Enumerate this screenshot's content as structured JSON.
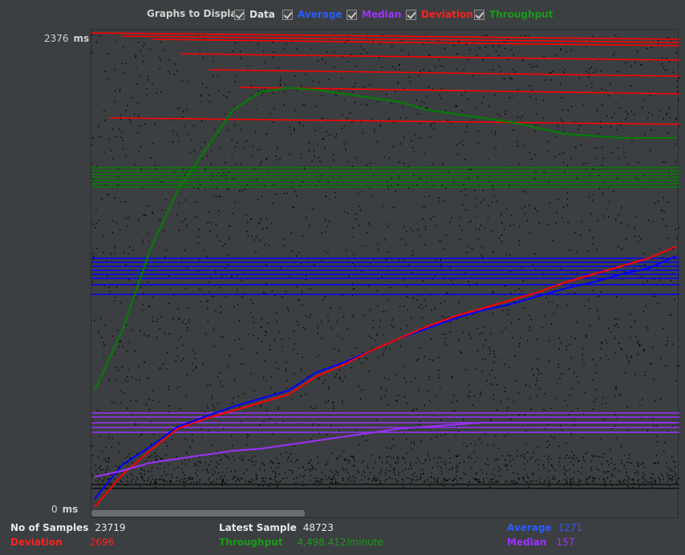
{
  "legend": {
    "title": "Graphs to Display",
    "items": [
      {
        "label": "Data",
        "color": "#e0e0e0"
      },
      {
        "label": "Average",
        "color": "#0000ff"
      },
      {
        "label": "Median",
        "color": "#9b30ff"
      },
      {
        "label": "Deviation",
        "color": "#ff0000"
      },
      {
        "label": "Throughput",
        "color": "#008000"
      }
    ]
  },
  "axis": {
    "y_max_label": "2376",
    "y_min_label": "0",
    "unit": "ms"
  },
  "stats": {
    "samples_label": "No of Samples",
    "samples_value": "23719",
    "latest_label": "Latest Sample",
    "latest_value": "48723",
    "average_label": "Average",
    "average_value": "1271",
    "deviation_label": "Deviation",
    "deviation_value": "2696",
    "throughput_label": "Throughput",
    "throughput_value": "4,498.412/minute",
    "median_label": "Median",
    "median_value": "157"
  },
  "chart_data": {
    "type": "line",
    "ylim": [
      0,
      2376
    ],
    "series": [
      {
        "name": "Average",
        "color": "#0000ff",
        "values": [
          60,
          230,
          320,
          420,
          470,
          520,
          560,
          600,
          690,
          740,
          800,
          860,
          910,
          960,
          1000,
          1030,
          1070,
          1110,
          1140,
          1180,
          1210,
          1271
        ]
      },
      {
        "name": "Deviation",
        "color": "#ff0000",
        "values": [
          20,
          180,
          300,
          410,
          460,
          500,
          540,
          580,
          670,
          730,
          800,
          860,
          920,
          970,
          1010,
          1050,
          1090,
          1140,
          1180,
          1220,
          1260,
          1320
        ]
      },
      {
        "name": "Median",
        "color": "#9b30ff",
        "values": [
          170,
          200,
          240,
          260,
          280,
          300,
          310,
          330,
          350,
          370,
          390,
          410,
          420,
          430,
          440,
          440,
          440,
          440,
          440,
          440,
          440,
          440
        ]
      },
      {
        "name": "Throughput",
        "color": "#008000",
        "values": [
          600,
          900,
          1300,
          1600,
          1800,
          2000,
          2090,
          2110,
          2100,
          2080,
          2060,
          2040,
          2000,
          1980,
          1960,
          1940,
          1910,
          1880,
          1870,
          1860,
          1860,
          1860
        ]
      }
    ]
  }
}
